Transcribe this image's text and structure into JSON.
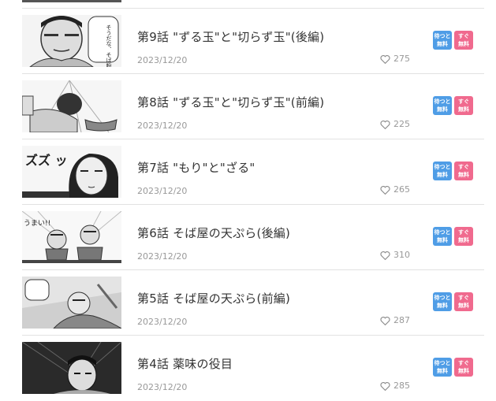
{
  "colors": {
    "wait_badge": "#4f9de6",
    "instant_badge": "#f06a8e",
    "meta_text": "#999999",
    "separator": "#e2e2e2"
  },
  "episodes": [
    {
      "title": "第9話 \"ずる玉\"と\"切らず玉\"(後編)",
      "date": "2023/12/20",
      "likes": "275",
      "thumbnail_text": "そうだな、そば粉が変わった…",
      "badge_wait": [
        "待つと",
        "無料"
      ],
      "badge_instant": [
        "すぐ",
        "無料"
      ]
    },
    {
      "title": "第8話 \"ずる玉\"と\"切らず玉\"(前編)",
      "date": "2023/12/20",
      "likes": "225",
      "badge_wait": [
        "待つと",
        "無料"
      ],
      "badge_instant": [
        "すぐ",
        "無料"
      ]
    },
    {
      "title": "第7話 \"もり\"と\"ざる\"",
      "date": "2023/12/20",
      "likes": "265",
      "thumbnail_text": "ズズ ッ",
      "badge_wait": [
        "待つと",
        "無料"
      ],
      "badge_instant": [
        "すぐ",
        "無料"
      ]
    },
    {
      "title": "第6話 そば屋の天ぷら(後編)",
      "date": "2023/12/20",
      "likes": "310",
      "thumbnail_text": "うまい!!",
      "badge_wait": [
        "待つと",
        "無料"
      ],
      "badge_instant": [
        "すぐ",
        "無料"
      ]
    },
    {
      "title": "第5話 そば屋の天ぷら(前編)",
      "date": "2023/12/20",
      "likes": "287",
      "badge_wait": [
        "待つと",
        "無料"
      ],
      "badge_instant": [
        "すぐ",
        "無料"
      ]
    },
    {
      "title": "第4話 薬味の役目",
      "date": "2023/12/20",
      "likes": "285",
      "badge_wait": [
        "待つと",
        "無料"
      ],
      "badge_instant": [
        "すぐ",
        "無料"
      ]
    }
  ]
}
